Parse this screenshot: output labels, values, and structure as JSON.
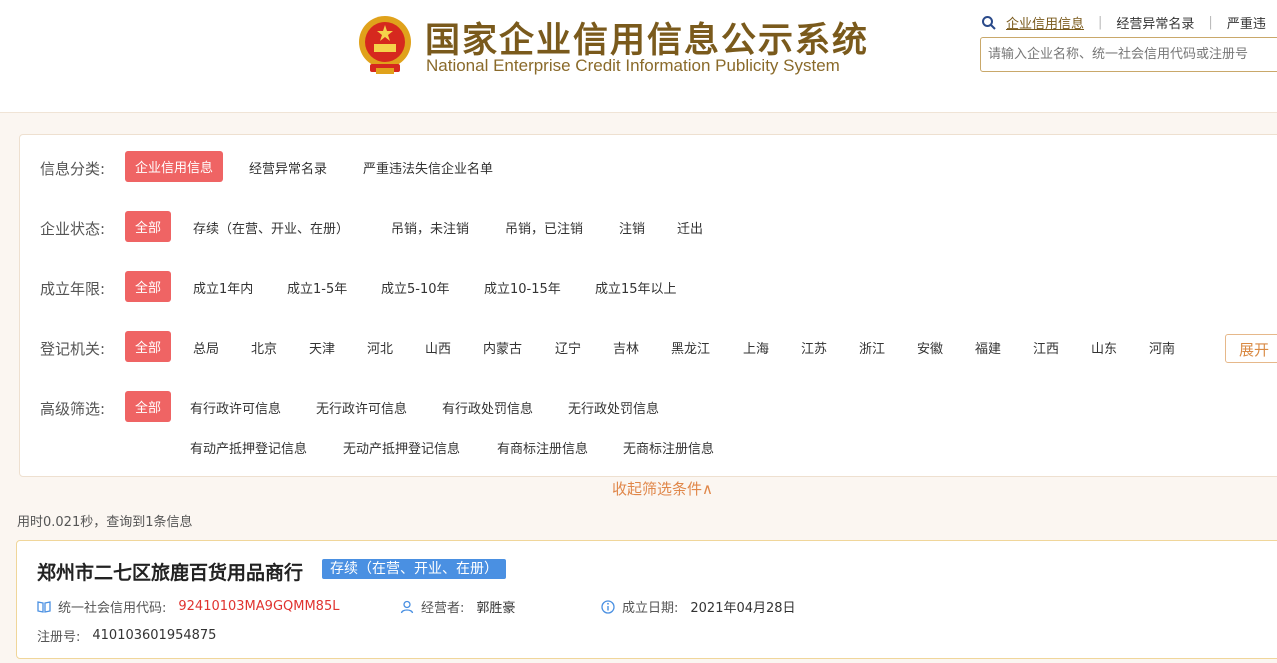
{
  "header": {
    "title_cn": "国家企业信用信息公示系统",
    "title_en": "National Enterprise Credit Information Publicity System",
    "nav": [
      "企业信用信息",
      "经营异常名录",
      "严重违"
    ],
    "search_placeholder": "请输入企业名称、统一社会信用代码或注册号",
    "colors": {
      "brand": "#7a5a1c",
      "accent": "#ef6464"
    }
  },
  "filters": {
    "category": {
      "label": "信息分类:",
      "options": [
        "企业信用信息",
        "经营异常名录",
        "严重违法失信企业名单"
      ]
    },
    "status": {
      "label": "企业状态:",
      "options": [
        "全部",
        "存续（在营、开业、在册）",
        "吊销，未注销",
        "吊销，已注销",
        "注销",
        "迁出"
      ]
    },
    "age": {
      "label": "成立年限:",
      "options": [
        "全部",
        "成立1年内",
        "成立1-5年",
        "成立5-10年",
        "成立10-15年",
        "成立15年以上"
      ]
    },
    "authority": {
      "label": "登记机关:",
      "options": [
        "全部",
        "总局",
        "北京",
        "天津",
        "河北",
        "山西",
        "内蒙古",
        "辽宁",
        "吉林",
        "黑龙江",
        "上海",
        "江苏",
        "浙江",
        "安徽",
        "福建",
        "江西",
        "山东",
        "河南"
      ],
      "expand_label": "展开"
    },
    "advanced": {
      "label": "高级筛选:",
      "options": [
        "全部",
        "有行政许可信息",
        "无行政许可信息",
        "有行政处罚信息",
        "无行政处罚信息",
        "有动产抵押登记信息",
        "无动产抵押登记信息",
        "有商标注册信息",
        "无商标注册信息"
      ]
    },
    "collapse_label": "收起筛选条件∧"
  },
  "stats": "用时0.021秒，查询到1条信息",
  "result": {
    "name": "郑州市二七区旅鹿百货用品商行",
    "status": "存续（在营、开业、在册）",
    "credit_code_label": "统一社会信用代码:",
    "credit_code": "92410103MA9GQMM85L",
    "operator_label": "经营者:",
    "operator": "郭胜豪",
    "date_label": "成立日期:",
    "date": "2021年04月28日",
    "reg_no_label": "注册号:",
    "reg_no": "410103601954875"
  }
}
